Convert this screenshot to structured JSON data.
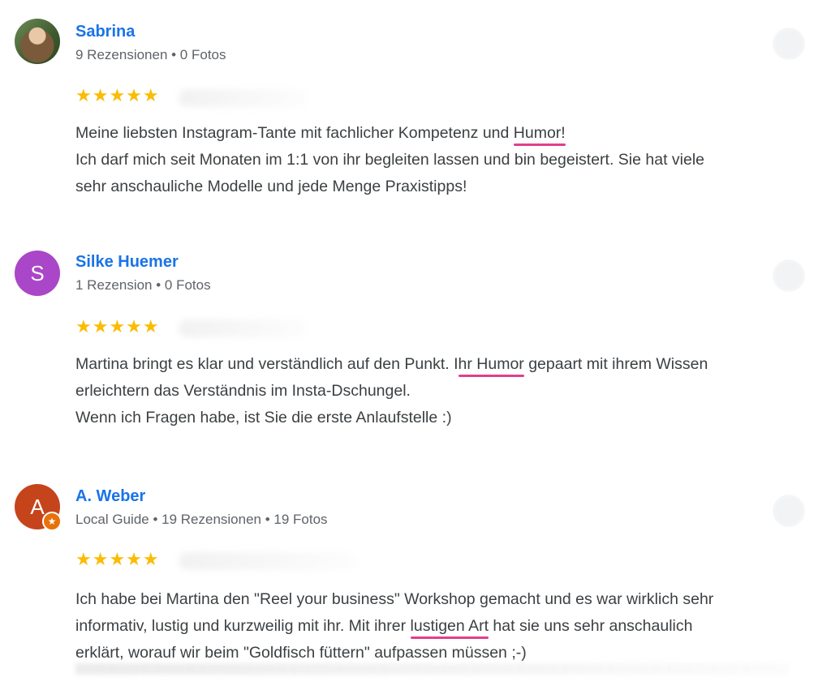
{
  "colors": {
    "name": "#1a73e8",
    "star": "#fbbc04",
    "highlight_underline": "#e0408a",
    "avatar_s": "#a947c8",
    "avatar_a": "#c5441c",
    "guide_badge": "#e8710a"
  },
  "reviews": [
    {
      "name": "Sabrina",
      "meta": "9 Rezensionen • 0 Fotos",
      "avatar_initial": "",
      "rating": 5,
      "stars": "★★★★★",
      "text": [
        [
          "Meine liebsten Instagram-Tante mit fachlicher Kompetenz und ",
          "Humor!",
          ""
        ],
        [
          "Ich darf mich seit Monaten im 1:1 von ihr begleiten lassen und bin begeistert. Sie hat viele",
          "",
          ""
        ],
        [
          "sehr anschauliche Modelle und jede Menge Praxistipps!",
          "",
          ""
        ]
      ]
    },
    {
      "name": "Silke Huemer",
      "meta": "1 Rezension • 0 Fotos",
      "avatar_initial": "S",
      "rating": 5,
      "stars": "★★★★★",
      "text": [
        [
          "Martina bringt es klar und verständlich auf den Punkt. I",
          "hr Humor",
          " gepaart mit ihrem Wissen"
        ],
        [
          "erleichtern das Verständnis im Insta-Dschungel.",
          "",
          ""
        ],
        [
          "Wenn ich Fragen habe, ist Sie die erste Anlaufstelle :)",
          "",
          ""
        ]
      ]
    },
    {
      "name": "A. Weber",
      "meta": "Local Guide • 19 Rezensionen • 19 Fotos",
      "avatar_initial": "A",
      "badge_icon": "★",
      "rating": 5,
      "stars": "★★★★★",
      "text": [
        [
          "Ich habe bei Martina den \"Reel your business\" Workshop gemacht und es war wirklich sehr",
          "",
          ""
        ],
        [
          "informativ, lustig und kurzweilig mit ihr. Mit ihrer ",
          "lustigen Art",
          " hat sie uns sehr anschaulich"
        ],
        [
          "erklärt, worauf wir beim \"Goldfisch füttern\" aufpassen müssen ;-)",
          "",
          ""
        ]
      ]
    }
  ]
}
